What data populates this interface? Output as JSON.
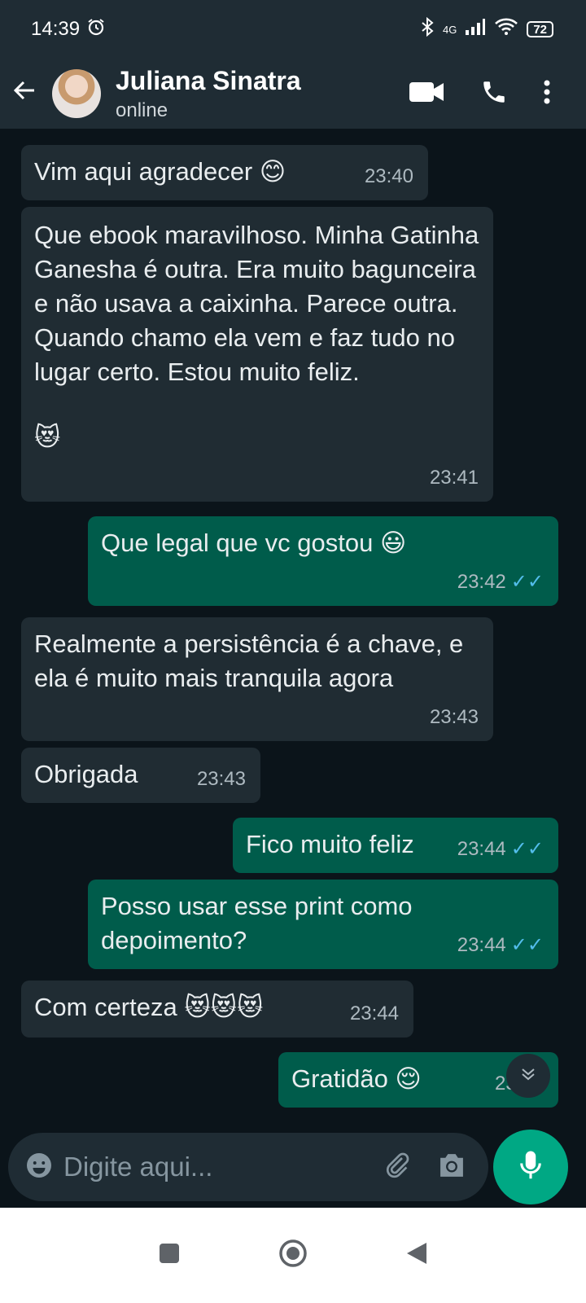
{
  "status": {
    "time": "14:39",
    "network": "4G",
    "battery": "72"
  },
  "header": {
    "name": "Juliana Sinatra",
    "status": "online"
  },
  "messages": [
    {
      "dir": "in",
      "text": "Vim aqui agradecer 😊",
      "time": "23:40"
    },
    {
      "dir": "in",
      "text": "Que ebook maravilhoso. Minha Gatinha Ganesha é outra. Era muito bagunceira e não usava a caixinha. Parece outra. Quando chamo ela vem e faz tudo no lugar certo. Estou muito feliz.",
      "extra": "😻",
      "time": "23:41"
    },
    {
      "dir": "out",
      "text": "Que legal que vc gostou 😃",
      "time": "23:42"
    },
    {
      "dir": "in",
      "text": "Realmente a persistência é a chave, e ela é muito mais tranquila agora",
      "time": "23:43"
    },
    {
      "dir": "in",
      "text": "Obrigada",
      "time": "23:43"
    },
    {
      "dir": "out",
      "text": "Fico muito feliz",
      "time": "23:44"
    },
    {
      "dir": "out",
      "text": "Posso usar esse print como depoimento?",
      "time": "23:44"
    },
    {
      "dir": "in",
      "text": "Com certeza 😻😻😻",
      "time": "23:44"
    },
    {
      "dir": "out",
      "text": "Gratidão 😌",
      "time": "23:46"
    }
  ],
  "input": {
    "placeholder": "Digite aqui..."
  },
  "colors": {
    "incoming": "#202c33",
    "outgoing": "#005c4b",
    "accent": "#00a884",
    "read_ticks": "#53bdeb"
  }
}
